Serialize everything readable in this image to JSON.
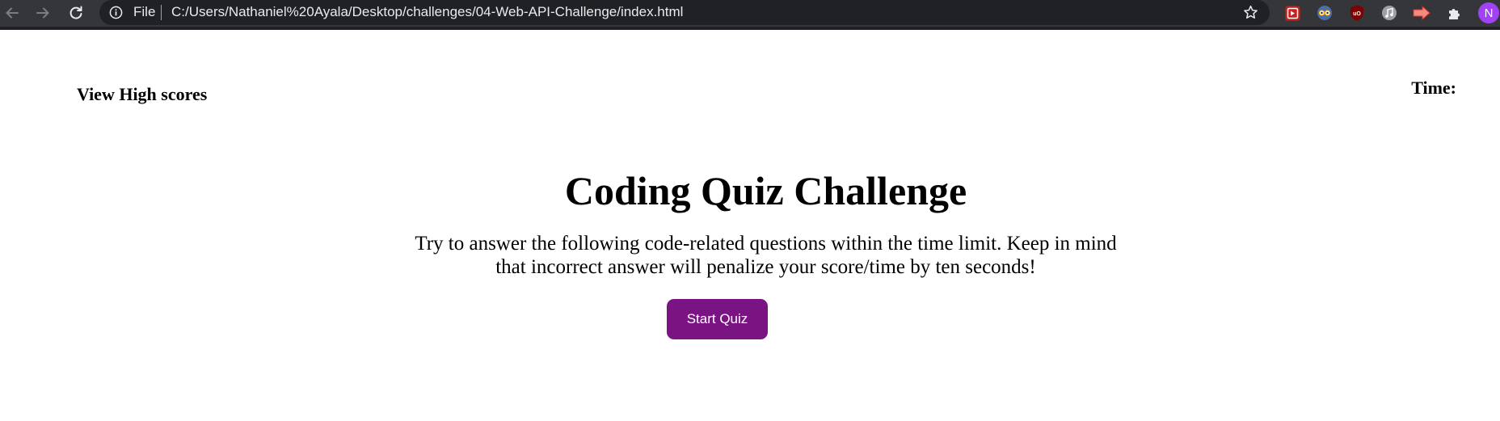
{
  "browser": {
    "scheme_label": "File",
    "url": "C:/Users/Nathaniel%20Ayala/Desktop/challenges/04-Web-API-Challenge/index.html",
    "profile_initial": "N",
    "profile_color": "#a142f4",
    "extensions": [
      "red-play-extension-icon",
      "glasses-extension-icon",
      "ublock-origin-icon",
      "music-extension-icon",
      "red-arrow-extension-icon",
      "puzzle-icon"
    ]
  },
  "page": {
    "view_scores_link": "View High scores",
    "timer_label": "Time:",
    "timer_value": "",
    "title": "Coding Quiz Challenge",
    "description": "Try to answer the following code-related questions within the time limit. Keep in mind that incorrect answer will penalize your score/time by ten seconds!",
    "start_button_label": "Start Quiz",
    "accent_color": "#7a1483"
  }
}
